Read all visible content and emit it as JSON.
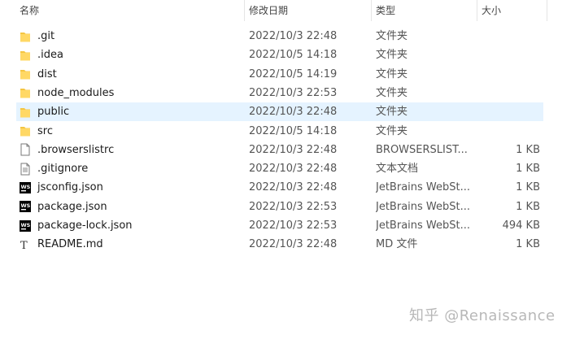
{
  "columns": {
    "name": "名称",
    "date": "修改日期",
    "type": "类型",
    "size": "大小",
    "sort_indicator": "^"
  },
  "files": [
    {
      "name": ".git",
      "date": "2022/10/3 22:48",
      "type": "文件夹",
      "size": "",
      "icon": "folder-icon"
    },
    {
      "name": ".idea",
      "date": "2022/10/5 14:18",
      "type": "文件夹",
      "size": "",
      "icon": "folder-icon"
    },
    {
      "name": "dist",
      "date": "2022/10/5 14:19",
      "type": "文件夹",
      "size": "",
      "icon": "folder-icon"
    },
    {
      "name": "node_modules",
      "date": "2022/10/3 22:53",
      "type": "文件夹",
      "size": "",
      "icon": "folder-icon"
    },
    {
      "name": "public",
      "date": "2022/10/3 22:48",
      "type": "文件夹",
      "size": "",
      "icon": "folder-icon",
      "selected": true
    },
    {
      "name": "src",
      "date": "2022/10/5 14:18",
      "type": "文件夹",
      "size": "",
      "icon": "folder-icon"
    },
    {
      "name": ".browserslistrc",
      "date": "2022/10/3 22:48",
      "type": "BROWSERSLIST...",
      "size": "1 KB",
      "icon": "file-icon"
    },
    {
      "name": ".gitignore",
      "date": "2022/10/3 22:48",
      "type": "文本文档",
      "size": "1 KB",
      "icon": "text-file-icon"
    },
    {
      "name": "jsconfig.json",
      "date": "2022/10/3 22:48",
      "type": "JetBrains WebSt...",
      "size": "1 KB",
      "icon": "webstorm-icon"
    },
    {
      "name": "package.json",
      "date": "2022/10/3 22:53",
      "type": "JetBrains WebSt...",
      "size": "1 KB",
      "icon": "webstorm-icon"
    },
    {
      "name": "package-lock.json",
      "date": "2022/10/3 22:53",
      "type": "JetBrains WebSt...",
      "size": "494 KB",
      "icon": "webstorm-icon"
    },
    {
      "name": "README.md",
      "date": "2022/10/3 22:48",
      "type": "MD 文件",
      "size": "1 KB",
      "icon": "markdown-icon"
    }
  ],
  "watermark": "知乎 @Renaissance",
  "colors": {
    "selected_row": "#e5f3ff",
    "folder": "#f4c542",
    "webstorm": "#000000"
  }
}
